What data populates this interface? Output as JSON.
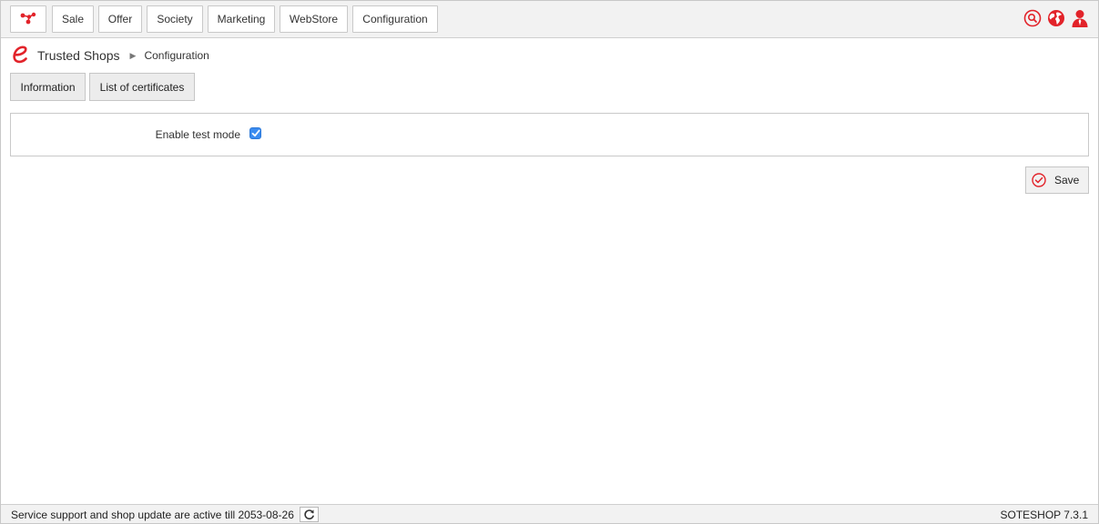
{
  "nav": {
    "items": [
      {
        "label": "Sale"
      },
      {
        "label": "Offer"
      },
      {
        "label": "Society"
      },
      {
        "label": "Marketing"
      },
      {
        "label": "WebStore"
      },
      {
        "label": "Configuration"
      }
    ],
    "logo_icon": "network-logo-icon",
    "right_icons": [
      "search-icon",
      "globe-icon",
      "user-icon"
    ]
  },
  "breadcrumb": {
    "app_icon": "e-logo-icon",
    "app": "Trusted Shops",
    "page": "Configuration"
  },
  "tabs": [
    {
      "label": "Information"
    },
    {
      "label": "List of certificates"
    }
  ],
  "form": {
    "test_mode_label": "Enable test mode",
    "test_mode_checked": true
  },
  "save_label": "Save",
  "footer": {
    "support_text": "Service support and shop update are active till 2053-08-26",
    "version": "SOTESHOP 7.3.1"
  },
  "colors": {
    "accent": "#e2232a",
    "checkbox": "#3b8cf0",
    "toolbar_bg": "#f2f2f2"
  }
}
